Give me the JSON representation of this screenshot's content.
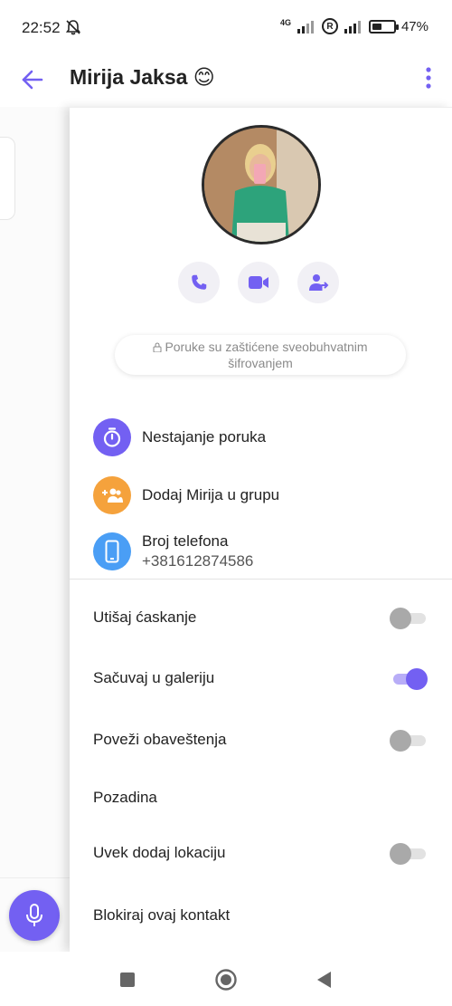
{
  "status_bar": {
    "time": "22:52",
    "network": "4G",
    "battery_percent": "47%",
    "battery_level": 0.47,
    "icons": [
      "bell-muted-icon",
      "signal-icon",
      "roaming-icon",
      "signal-icon",
      "battery-icon"
    ]
  },
  "header": {
    "title": "Mirija Jaksa 😊",
    "back_icon": "arrow-left-icon",
    "menu_icon": "more-vertical-icon"
  },
  "profile": {
    "actions": [
      "phone-icon",
      "video-icon",
      "add-person-icon"
    ],
    "encryption_line1": "Poruke su zaštićene sveobuhvatnim",
    "encryption_line2": "šifrovanjem"
  },
  "info_items": [
    {
      "label": "Nestajanje poruka",
      "icon": "timer-icon",
      "color": "#7360f2"
    },
    {
      "label": "Dodaj Mirija u grupu",
      "icon": "group-add-icon",
      "color": "#f5a23c"
    },
    {
      "label": "Broj telefona",
      "sub": "+381612874586",
      "icon": "phone-device-icon",
      "color": "#4a9ef5"
    }
  ],
  "settings": [
    {
      "label": "Utišaj ćaskanje",
      "toggle": true,
      "on": false
    },
    {
      "label": "Sačuvaj u galeriju",
      "toggle": true,
      "on": true
    },
    {
      "label": "Poveži obaveštenja",
      "toggle": true,
      "on": false
    },
    {
      "label": "Pozadina",
      "toggle": false
    },
    {
      "label": "Uvek dodaj lokaciju",
      "toggle": true,
      "on": false
    },
    {
      "label": "Blokiraj ovaj kontakt",
      "toggle": false
    }
  ],
  "colors": {
    "accent": "#7360f2",
    "accent_light": "#b8adf7"
  }
}
